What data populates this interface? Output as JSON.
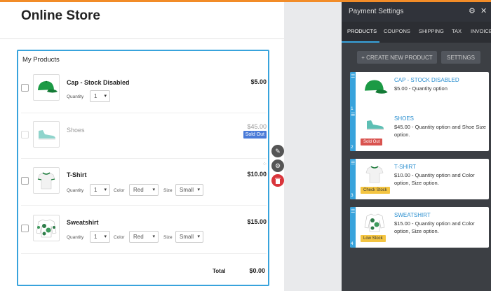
{
  "store": {
    "title": "Online Store",
    "card_title": "My Products",
    "total_label": "Total",
    "total_value": "$0.00",
    "products": [
      {
        "name": "Cap - Stock Disabled",
        "price": "$5.00",
        "quantity_label": "Quantity",
        "quantity": "1"
      },
      {
        "name": "Shoes",
        "price": "$45.00",
        "badge": "Sold Out"
      },
      {
        "name": "T-Shirt",
        "price": "$10.00",
        "quantity_label": "Quantity",
        "quantity": "1",
        "color_label": "Color",
        "color": "Red",
        "size_label": "Size",
        "size": "Small"
      },
      {
        "name": "Sweatshirt",
        "price": "$15.00",
        "quantity_label": "Quantity",
        "quantity": "1",
        "color_label": "Color",
        "color": "Red",
        "size_label": "Size",
        "size": "Small"
      }
    ]
  },
  "panel": {
    "title": "Payment Settings",
    "tabs": [
      "PRODUCTS",
      "COUPONS",
      "SHIPPING",
      "TAX",
      "INVOICE"
    ],
    "create_button": "+ CREATE NEW PRODUCT",
    "settings_button": "SETTINGS",
    "items": [
      {
        "title": "CAP - STOCK DISABLED",
        "desc": "$5.00 - Quantity option",
        "num": "1"
      },
      {
        "title": "SHOES",
        "desc": "$45.00 - Quantity option and Shoe Size option.",
        "num": "2",
        "badge": "Sold Out"
      },
      {
        "title": "T-SHIRT",
        "desc": "$10.00 - Quantity option and Color option, Size option.",
        "num": "3",
        "badge": "Check Stock"
      },
      {
        "title": "SWEATSHIRT",
        "desc": "$15.00 - Quantity option and Color option, Size option.",
        "num": "4",
        "badge": "Low Stock"
      }
    ]
  },
  "icons": {
    "gear": "gear-icon",
    "close": "close-icon",
    "brush": "brush-icon",
    "trash": "trash-icon",
    "chevron": "chevron-down-icon",
    "drag": "drag-handle-icon"
  },
  "colors": {
    "accent": "#38a3dc",
    "top_bar": "#f28c28",
    "sold_out": "#4a7bd8",
    "delete": "#d9353b",
    "panel_bg": "#3c3f44"
  }
}
